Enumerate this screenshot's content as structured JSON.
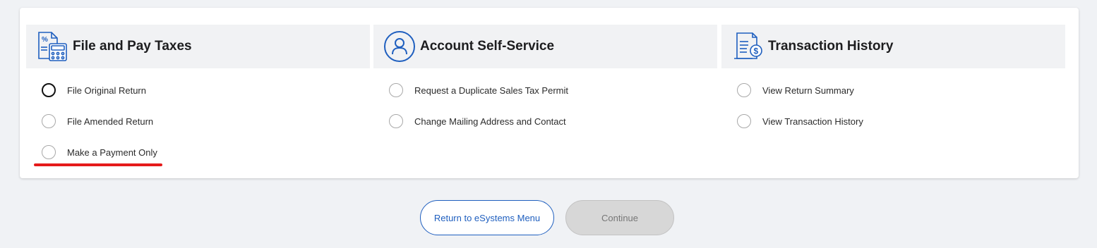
{
  "sections": [
    {
      "title": "File and Pay Taxes",
      "icon": "calculator-document-icon",
      "options": [
        {
          "label": "File Original Return"
        },
        {
          "label": "File Amended Return"
        },
        {
          "label": "Make a Payment Only"
        }
      ]
    },
    {
      "title": "Account Self-Service",
      "icon": "user-circle-icon",
      "options": [
        {
          "label": "Request a Duplicate Sales Tax Permit"
        },
        {
          "label": "Change Mailing Address and Contact"
        }
      ]
    },
    {
      "title": "Transaction History",
      "icon": "receipt-dollar-icon",
      "options": [
        {
          "label": "View Return Summary"
        },
        {
          "label": "View Transaction History"
        }
      ]
    }
  ],
  "buttons": {
    "return_label": "Return to eSystems Menu",
    "continue_label": "Continue"
  },
  "colors": {
    "accent": "#1f5fbf",
    "annotation": "#e51b1b",
    "header_bg": "#f1f2f4",
    "page_bg": "#f0f2f5"
  }
}
